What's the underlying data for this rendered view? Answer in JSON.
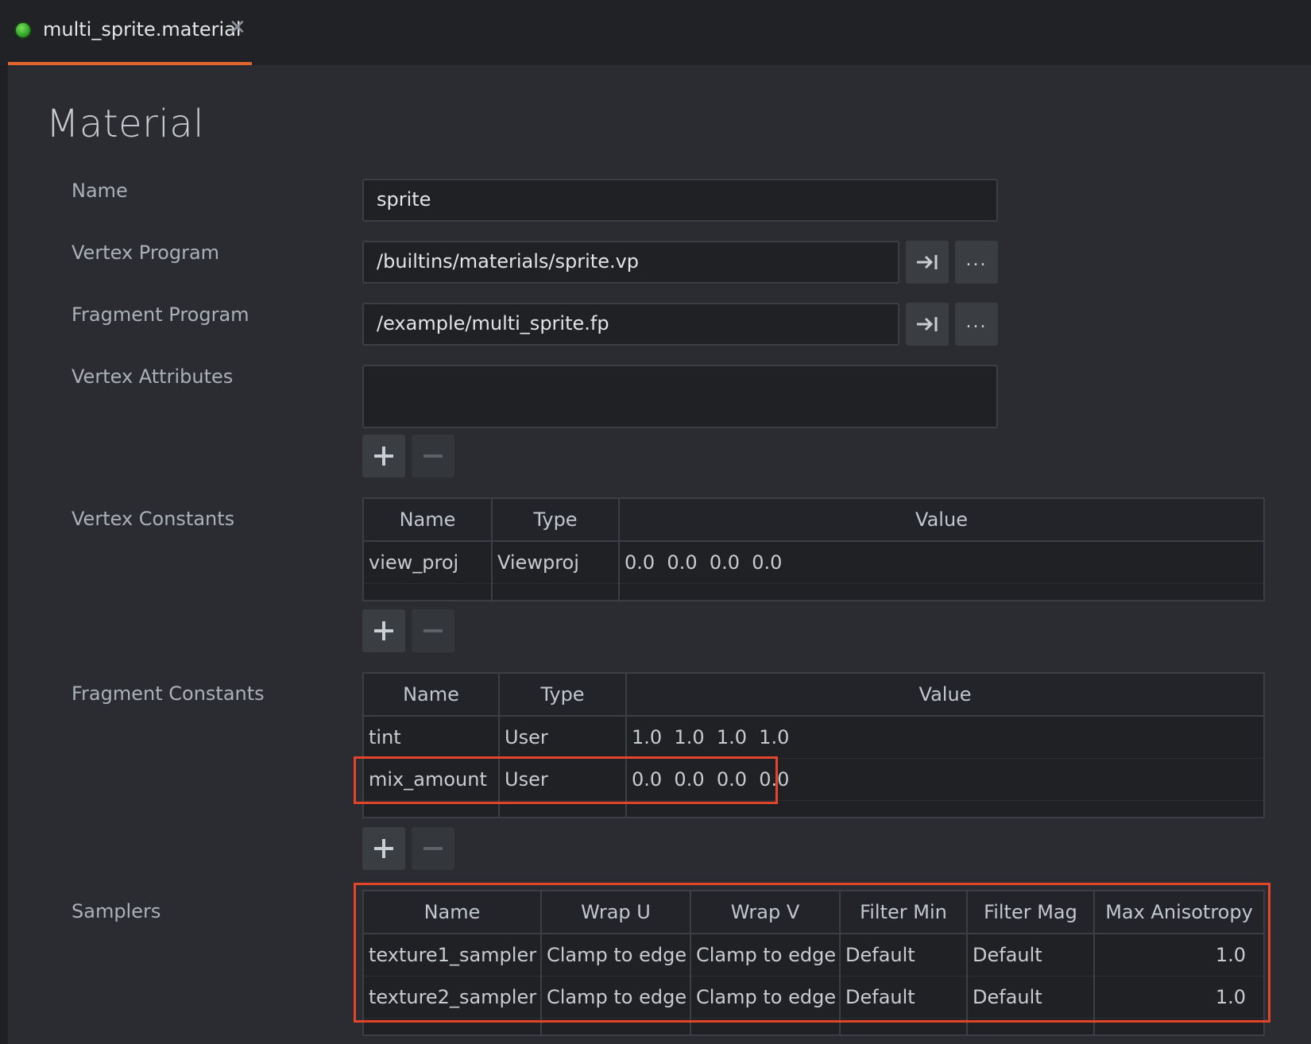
{
  "tab": {
    "title": "multi_sprite.material",
    "close_icon": "close-icon"
  },
  "page": {
    "title": "Material"
  },
  "fields": {
    "name": {
      "label": "Name",
      "value": "sprite"
    },
    "vertex_program": {
      "label": "Vertex Program",
      "value": "/builtins/materials/sprite.vp"
    },
    "fragment_program": {
      "label": "Fragment Program",
      "value": "/example/multi_sprite.fp"
    },
    "vertex_attributes": {
      "label": "Vertex Attributes"
    },
    "browse_label": "..."
  },
  "vertex_constants": {
    "label": "Vertex Constants",
    "columns": [
      "Name",
      "Type",
      "Value"
    ],
    "rows": [
      {
        "name": "view_proj",
        "type": "Viewproj",
        "value": "0.0  0.0  0.0  0.0"
      }
    ]
  },
  "fragment_constants": {
    "label": "Fragment Constants",
    "columns": [
      "Name",
      "Type",
      "Value"
    ],
    "rows": [
      {
        "name": "tint",
        "type": "User",
        "value": "1.0  1.0  1.0  1.0"
      },
      {
        "name": "mix_amount",
        "type": "User",
        "value": "0.0  0.0  0.0  0.0"
      }
    ]
  },
  "samplers": {
    "label": "Samplers",
    "columns": [
      "Name",
      "Wrap U",
      "Wrap V",
      "Filter Min",
      "Filter Mag",
      "Max Anisotropy"
    ],
    "rows": [
      {
        "name": "texture1_sampler",
        "wrap_u": "Clamp to edge",
        "wrap_v": "Clamp to edge",
        "filter_min": "Default",
        "filter_mag": "Default",
        "max_anisotropy": "1.0"
      },
      {
        "name": "texture2_sampler",
        "wrap_u": "Clamp to edge",
        "wrap_v": "Clamp to edge",
        "filter_min": "Default",
        "filter_mag": "Default",
        "max_anisotropy": "1.0"
      }
    ]
  },
  "colors": {
    "accent": "#e2652e",
    "highlight": "#e2452a",
    "status_dot": "#34a92c"
  }
}
